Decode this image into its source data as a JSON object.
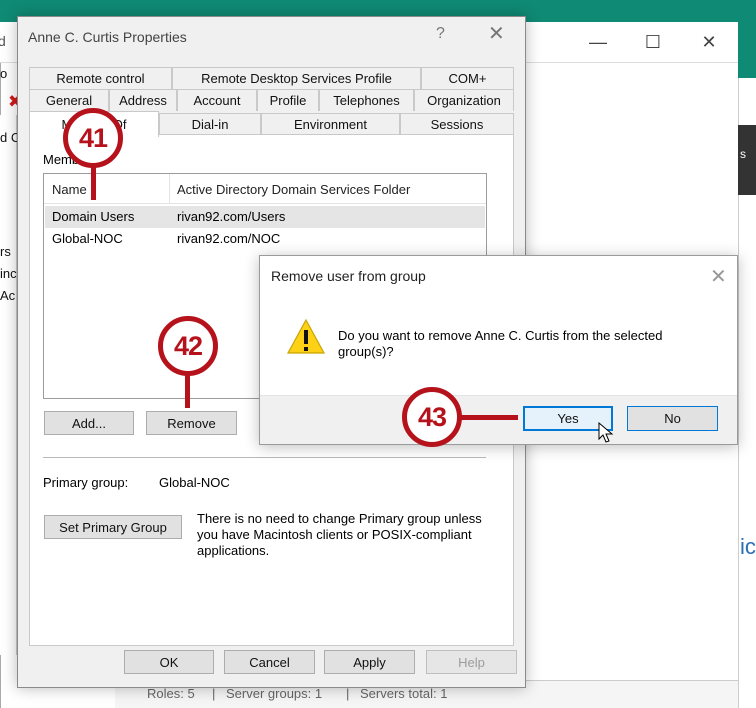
{
  "background": {
    "title_fragment": "d",
    "fragments": [
      "o",
      "d C",
      "rs",
      "inc",
      "Ac"
    ],
    "right_dark_fragment": "s",
    "right_blue_fragment": "ice",
    "status": [
      "Roles: 5",
      "|",
      "Server groups: 1",
      "|",
      "Servers total: 1"
    ]
  },
  "properties_dialog": {
    "title": "Anne C. Curtis Properties",
    "help_glyph": "?",
    "tabs_row1": [
      "Remote control",
      "Remote Desktop Services Profile",
      "COM+"
    ],
    "tabs_row2": [
      "General",
      "Address",
      "Account",
      "Profile",
      "Telephones",
      "Organization"
    ],
    "tabs_row3": [
      "Member Of",
      "Dial-in",
      "Environment",
      "Sessions"
    ],
    "members_label": "Member of:",
    "list_headers": [
      "Name",
      "Active Directory Domain Services Folder"
    ],
    "rows": [
      {
        "name": "Domain Users",
        "folder": "rivan92.com/Users"
      },
      {
        "name": "Global-NOC",
        "folder": "rivan92.com/NOC"
      }
    ],
    "add_button": "Add...",
    "remove_button": "Remove",
    "primary_group_label": "Primary group:",
    "primary_group_value": "Global-NOC",
    "set_primary_button": "Set Primary Group",
    "note": "There is no need to change Primary group unless you have Macintosh clients or POSIX-compliant applications.",
    "footer": {
      "ok": "OK",
      "cancel": "Cancel",
      "apply": "Apply",
      "help": "Help"
    }
  },
  "remove_dialog": {
    "title": "Remove user from group",
    "message": "Do you want to remove Anne C. Curtis from the selected group(s)?",
    "yes": "Yes",
    "no": "No"
  },
  "callouts": [
    "41",
    "42",
    "43"
  ],
  "colors": {
    "callout": "#b5121b",
    "accent": "#0078d7",
    "titlebar_teal": "#0f8a74"
  }
}
